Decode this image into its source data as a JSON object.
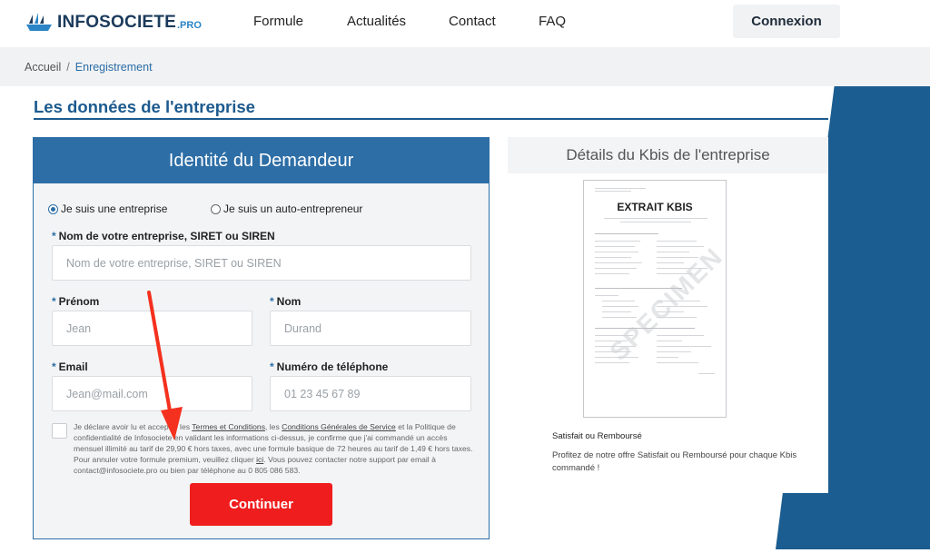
{
  "brand": {
    "name": "INFOSOCIETE",
    "suffix": ".PRO",
    "icon": "boat-logo-icon"
  },
  "nav": {
    "items": [
      "Formule",
      "Actualités",
      "Contact",
      "FAQ"
    ],
    "login": "Connexion"
  },
  "breadcrumb": {
    "home": "Accueil",
    "separator": "/",
    "current": "Enregistrement"
  },
  "section": {
    "title": "Les données de l'entreprise"
  },
  "form": {
    "title": "Identité du Demandeur",
    "radio_company": "Je suis une entreprise",
    "radio_auto": "Je suis un auto-entrepreneur",
    "company_label": "Nom de votre entreprise, SIRET ou SIREN",
    "company_placeholder": "Nom de votre entreprise, SIRET ou SIREN",
    "firstname_label": "Prénom",
    "firstname_placeholder": "Jean",
    "lastname_label": "Nom",
    "lastname_placeholder": "Durand",
    "email_label": "Email",
    "email_placeholder": "Jean@mail.com",
    "phone_label": "Numéro de téléphone",
    "phone_placeholder": "01 23 45 67 89",
    "required_mark": "*",
    "legal_1": "Je déclare avoir lu et accepter les",
    "legal_terms": "Termes et Conditions",
    "legal_2": ", les",
    "legal_cgs": "Conditions Générales de Service",
    "legal_3": "et la Politique de confidentialité de Infosociete en validant les informations ci-dessus, je confirme que j'ai commandé un accès mensuel illimité au tarif de 29,90 € hors taxes, avec une formule basique de 72 heures au tarif de 1,49 € hors taxes. Pour annuler votre formule premium, veuillez cliquer",
    "legal_here": "ici",
    "legal_4": ". Vous pouvez contacter notre support par email à contact@infosociete.pro ou bien par téléphone au 0 805 086 583.",
    "submit": "Continuer"
  },
  "kbis": {
    "title": "Détails du Kbis de l'entreprise",
    "doc_title": "EXTRAIT KBIS",
    "doc_stamp": "SPECIMEN",
    "guarantee_title": "Satisfait ou Remboursé",
    "guarantee_desc": "Profitez de notre offre Satisfait ou Remboursé pour chaque Kbis commandé !"
  },
  "colors": {
    "primary": "#2d6ea6",
    "cta": "#ef1d1d",
    "annotation_arrow": "#f4311e"
  }
}
